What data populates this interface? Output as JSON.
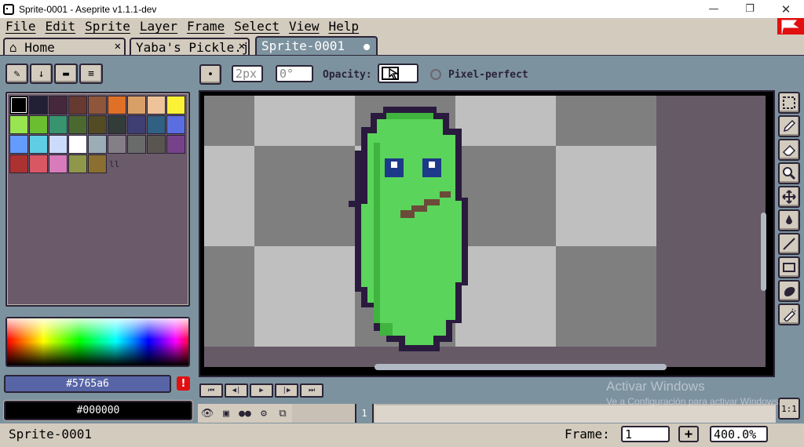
{
  "window": {
    "title": "Sprite-0001 - Aseprite v1.1.1-dev",
    "minimize": "—",
    "maximize": "❐",
    "close": "✕"
  },
  "menu": [
    "File",
    "Edit",
    "Sprite",
    "Layer",
    "Frame",
    "Select",
    "View",
    "Help"
  ],
  "tabs": [
    {
      "label": "Home",
      "close": "✕"
    },
    {
      "label": "Yaba's Pickle.j",
      "close": "✕"
    },
    {
      "label": "Sprite-0001"
    }
  ],
  "palette_toolbar": [
    "✎",
    "↓",
    "▬",
    "≡"
  ],
  "palette": {
    "colors": [
      "#000000",
      "#222034",
      "#45283c",
      "#663931",
      "#8f563b",
      "#df7126",
      "#d9a066",
      "#eec39a",
      "#fbf236",
      "#99e550",
      "#6abe30",
      "#37946e",
      "#4b692f",
      "#524b24",
      "#323c39",
      "#3f3f74",
      "#306082",
      "#5b6ee1",
      "#639bff",
      "#5fcde4",
      "#cbdbfc",
      "#ffffff",
      "#9badb7",
      "#847e87",
      "#696a6a",
      "#595652",
      "#76428a",
      "#ac3232",
      "#d95763",
      "#d77bba",
      "#8f974a",
      "#8a6f30"
    ],
    "grip": "ll"
  },
  "colors": {
    "foreground": "#5765a6",
    "background": "#000000",
    "warning": "!"
  },
  "context_bar": {
    "brush_size": "2px",
    "angle": "0°",
    "opacity_label": "Opacity:",
    "pixel_perfect_label": "Pixel-perfect"
  },
  "timeline": {
    "buttons": [
      "⏮",
      "◀|",
      "▶",
      "|▶",
      "⏭"
    ],
    "cel_number": "1"
  },
  "watermark": {
    "title": "Activar Windows",
    "subtitle": "Ve a Configuración para activar Windows."
  },
  "status": {
    "sprite_name": "Sprite-0001",
    "frame_label": "Frame:",
    "frame_value": "1",
    "plus": "+",
    "zoom": "400.0%",
    "one_to_one": "1:1"
  }
}
